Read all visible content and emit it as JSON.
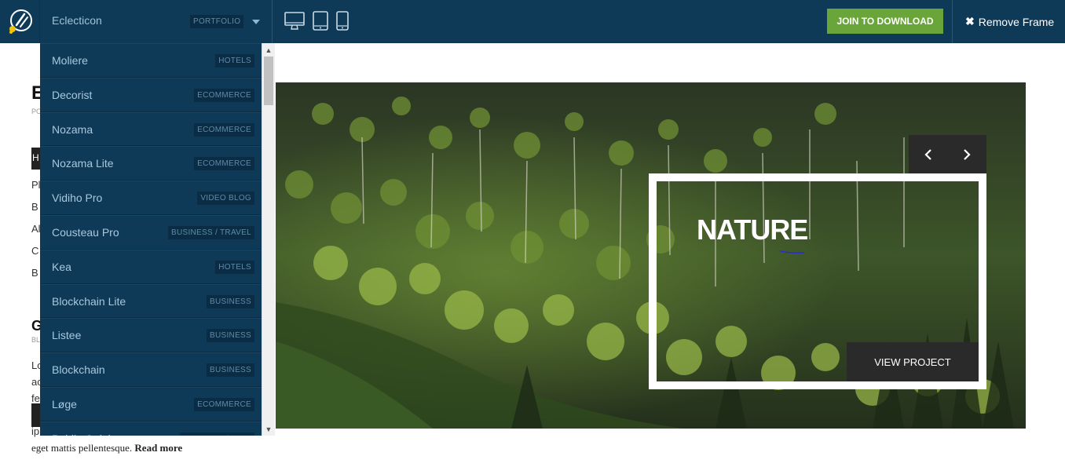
{
  "topbar": {
    "logo_icon": "paint-palette-logo-icon",
    "theme_selector": {
      "name": "Eclecticon",
      "category": "PORTFOLIO"
    },
    "devices": [
      "desktop-icon",
      "tablet-icon",
      "mobile-icon"
    ],
    "join_button": "JOIN TO DOWNLOAD",
    "remove_frame": {
      "icon": "close-icon",
      "label": "Remove Frame"
    },
    "colors": {
      "bar": "#0e3a57",
      "join": "#6aa539",
      "badge_bg": "#0a2d45"
    }
  },
  "dropdown": {
    "items": [
      {
        "name": "Moliere",
        "category": "HOTELS"
      },
      {
        "name": "Decorist",
        "category": "ECOMMERCE"
      },
      {
        "name": "Nozama",
        "category": "ECOMMERCE"
      },
      {
        "name": "Nozama Lite",
        "category": "ECOMMERCE"
      },
      {
        "name": "Vidiho Pro",
        "category": "VIDEO BLOG"
      },
      {
        "name": "Cousteau Pro",
        "category": "BUSINESS / TRAVEL"
      },
      {
        "name": "Kea",
        "category": "HOTELS"
      },
      {
        "name": "Blockchain Lite",
        "category": "BUSINESS"
      },
      {
        "name": "Listee",
        "category": "BUSINESS"
      },
      {
        "name": "Blockchain",
        "category": "BUSINESS"
      },
      {
        "name": "Løge",
        "category": "ECOMMERCE"
      },
      {
        "name": "Public Opinion",
        "category": "MAGAZINE/BLOG"
      }
    ]
  },
  "page": {
    "heading": "E",
    "heading_sub": "PO",
    "dark_letter": "H",
    "side_lines": [
      "Pl",
      "B",
      "Al",
      "C",
      "B"
    ],
    "heading2": "G",
    "heading2_sub": "BL",
    "body_lines": [
      "Lo",
      "ac",
      "fe",
      "ip"
    ],
    "bottom_text": "eget mattis pellentesque.",
    "read_more": "Read more"
  },
  "hero": {
    "title": "NATURE",
    "button": "VIEW PROJECT",
    "prev_icon": "chevron-left-icon",
    "next_icon": "chevron-right-icon"
  }
}
